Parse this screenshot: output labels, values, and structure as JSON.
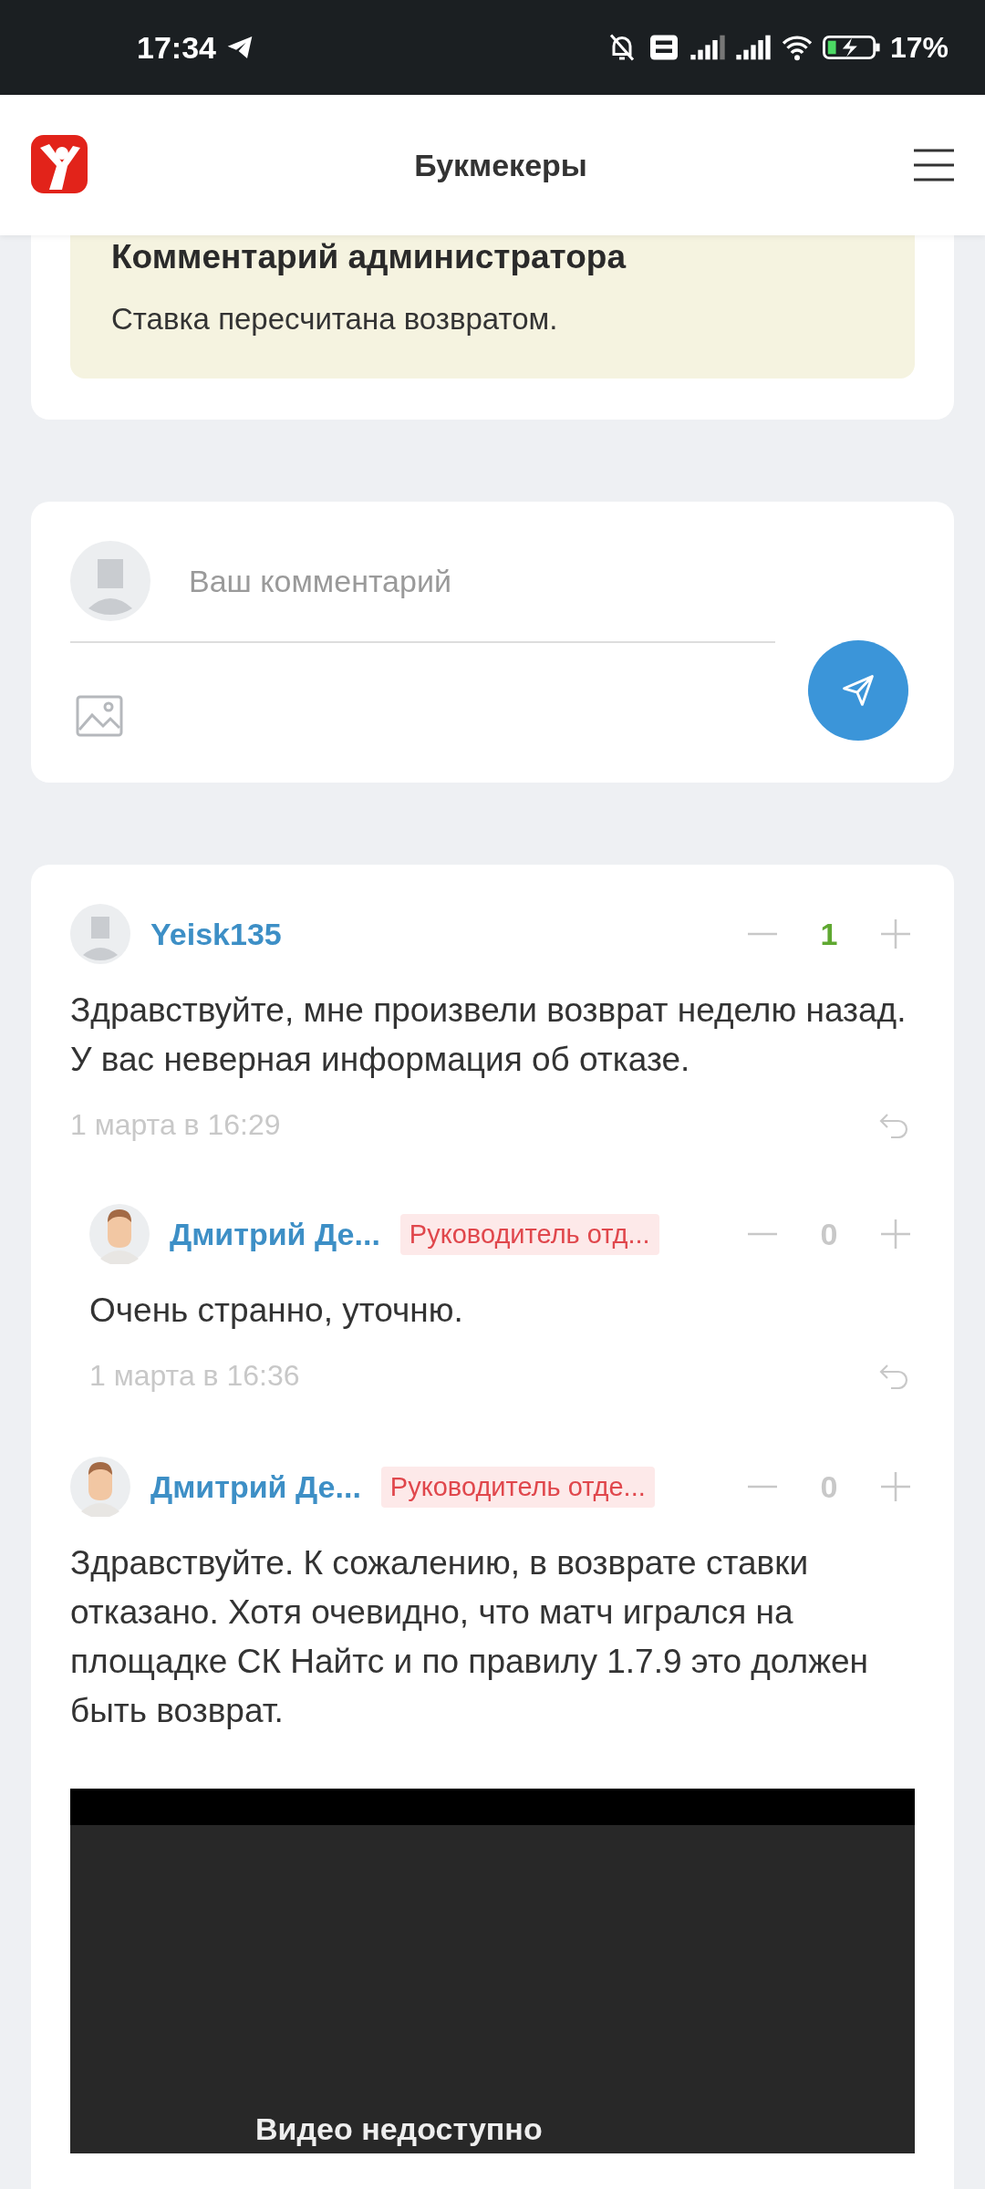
{
  "status_bar": {
    "time": "17:34",
    "battery": "17%"
  },
  "header": {
    "title": "Букмекеры"
  },
  "admin_comment": {
    "title": "Комментарий администратора",
    "text": "Ставка пересчитана возвратом."
  },
  "comment_form": {
    "placeholder": "Ваш комментарий"
  },
  "comments": [
    {
      "kind": "default",
      "author": "Yeisk135",
      "score": "1",
      "score_positive": true,
      "text": "Здравствуйте, мне произвели возврат неделю назад.\nУ вас неверная информация об отказе.",
      "date": "1 марта в 16:29",
      "replies": [
        {
          "kind": "person",
          "author": "Дмитрий Де...",
          "badge": "Руководитель отд...",
          "score": "0",
          "score_positive": false,
          "text": "Очень странно, уточню.",
          "date": "1 марта в 16:36"
        }
      ]
    },
    {
      "kind": "person",
      "author": "Дмитрий Де...",
      "badge": "Руководитель отде...",
      "score": "0",
      "score_positive": false,
      "text": "Здравствуйте. К сожалению, в возврате ставки отказано. Хотя очевидно, что матч игрался на площадке СК Найтс и по правилу 1.7.9 это должен быть возврат.",
      "video": {
        "message": "Видео недоступно"
      }
    }
  ]
}
